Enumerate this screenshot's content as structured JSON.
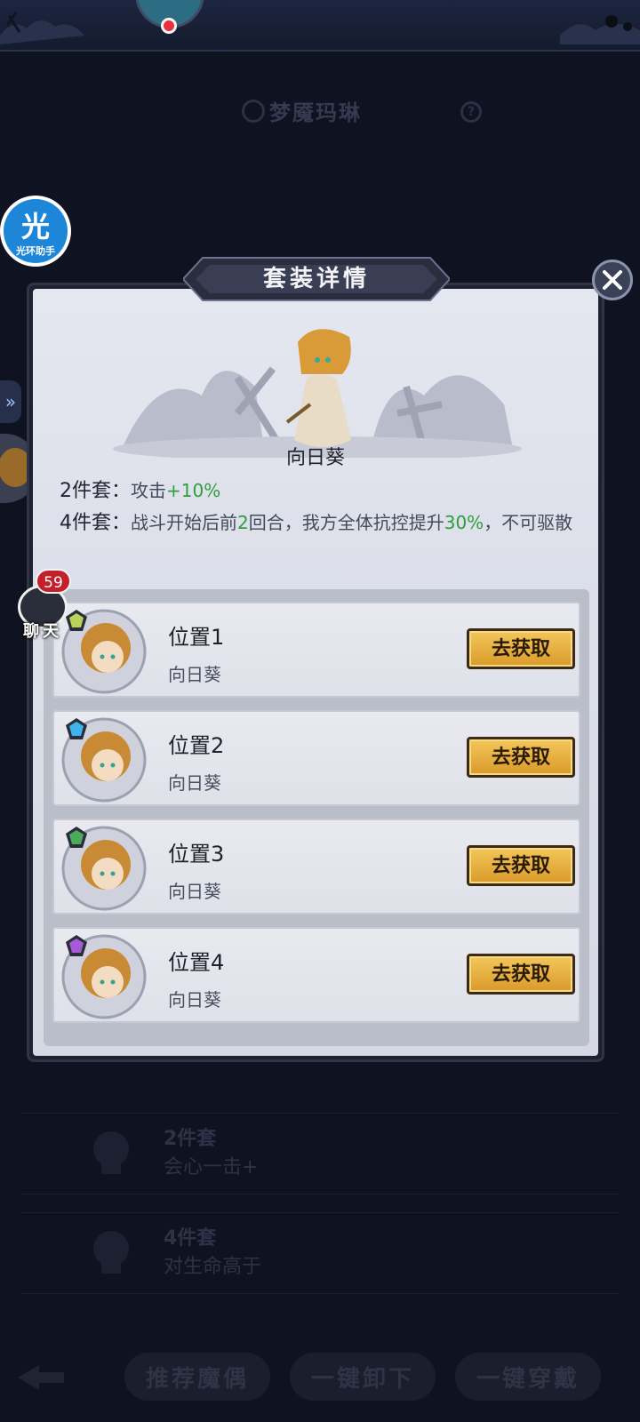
{
  "background": {
    "character_name": "梦魇玛琳",
    "set_rows": [
      {
        "title": "2件套",
        "desc": "会心一击+"
      },
      {
        "title": "4件套",
        "desc": "对生命高于"
      }
    ],
    "bottom_buttons": [
      "推荐魔偶",
      "一键卸下",
      "一键穿戴"
    ]
  },
  "assistant": {
    "char": "光",
    "label": "光环助手"
  },
  "chat": {
    "label": "聊天",
    "badge": "59"
  },
  "modal": {
    "title": "套装详情",
    "set_name": "向日葵",
    "bonus_2": {
      "label": "2件套：",
      "text_a": "攻击",
      "value": "+10%"
    },
    "bonus_4": {
      "label": "4件套：",
      "text_a": "战斗开始后前",
      "rounds": "2",
      "text_b": "回合，我方全体抗控提升",
      "value": "30%",
      "text_c": "，不可驱散"
    },
    "slots": [
      {
        "title": "位置1",
        "item": "向日葵",
        "button": "去获取",
        "gem_color": "#b9d35a"
      },
      {
        "title": "位置2",
        "item": "向日葵",
        "button": "去获取",
        "gem_color": "#3fb4ea"
      },
      {
        "title": "位置3",
        "item": "向日葵",
        "button": "去获取",
        "gem_color": "#4caa58"
      },
      {
        "title": "位置4",
        "item": "向日葵",
        "button": "去获取",
        "gem_color": "#a65ad8"
      }
    ]
  },
  "colors": {
    "highlight_green": "#2e9e3e",
    "button_gold": "#e6ac3c",
    "badge_red": "#c3202a"
  }
}
